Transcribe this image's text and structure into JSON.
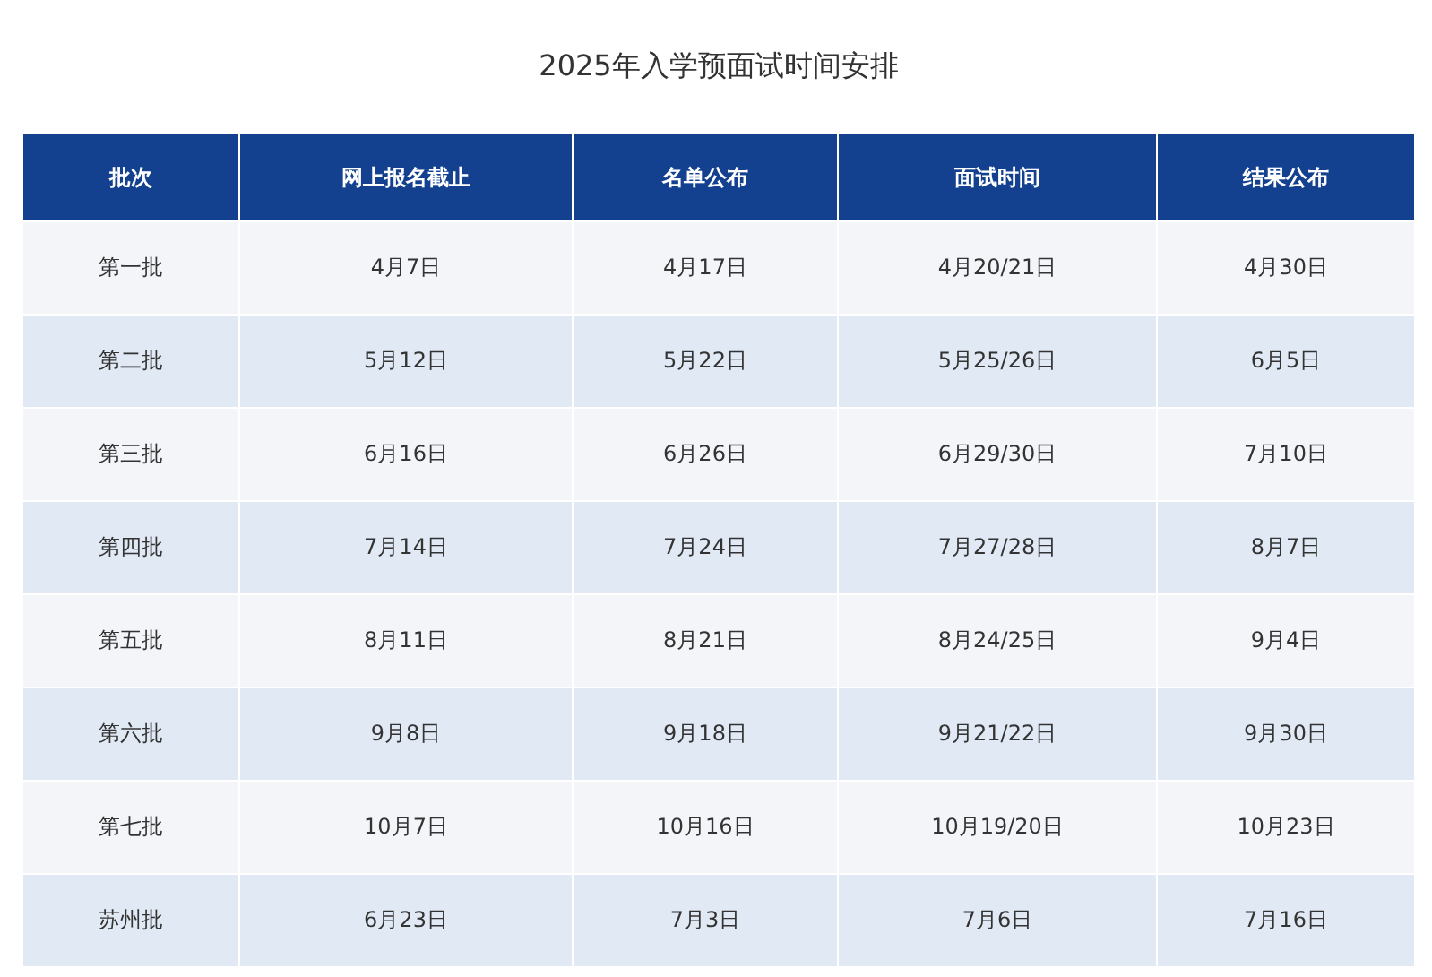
{
  "title": "2025年入学预面试时间安排",
  "table": {
    "columns": [
      "批次",
      "网上报名截止",
      "名单公布",
      "面试时间",
      "结果公布"
    ],
    "rows": [
      [
        "第一批",
        "4月7日",
        "4月17日",
        "4月20/21日",
        "4月30日"
      ],
      [
        "第二批",
        "5月12日",
        "5月22日",
        "5月25/26日",
        "6月5日"
      ],
      [
        "第三批",
        "6月16日",
        "6月26日",
        "6月29/30日",
        "7月10日"
      ],
      [
        "第四批",
        "7月14日",
        "7月24日",
        "7月27/28日",
        "8月7日"
      ],
      [
        "第五批",
        "8月11日",
        "8月21日",
        "8月24/25日",
        "9月4日"
      ],
      [
        "第六批",
        "9月8日",
        "9月18日",
        "9月21/22日",
        "9月30日"
      ],
      [
        "第七批",
        "10月7日",
        "10月16日",
        "10月19/20日",
        "10月23日"
      ],
      [
        "苏州批",
        "6月23日",
        "7月3日",
        "7月6日",
        "7月16日"
      ]
    ]
  }
}
